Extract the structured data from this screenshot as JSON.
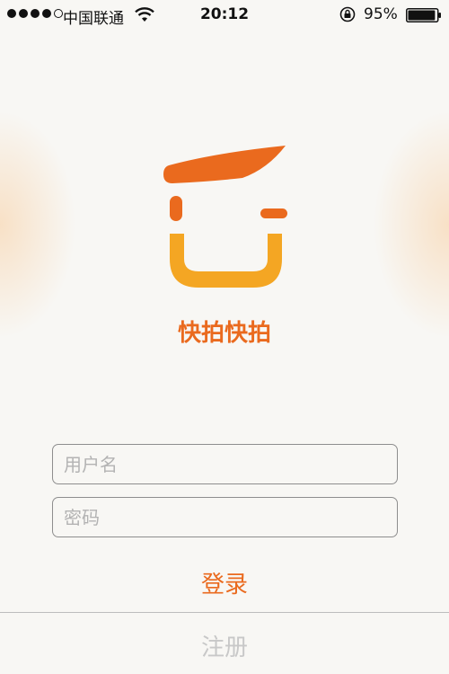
{
  "status_bar": {
    "signal_bars": 5,
    "signal_filled": 4,
    "carrier": "中国联通",
    "time": "20:12",
    "battery_percent": "95%",
    "battery_level": 0.95,
    "icons": [
      "wifi-icon",
      "orientation-lock-icon",
      "battery-icon"
    ]
  },
  "app": {
    "name": "快拍快拍",
    "logo_icon": "app-logo-icon",
    "brand_color": "#ea6a1e",
    "accent_color": "#f4a623"
  },
  "form": {
    "username_placeholder": "用户名",
    "password_placeholder": "密码",
    "login_label": "登录",
    "register_label": "注册"
  }
}
